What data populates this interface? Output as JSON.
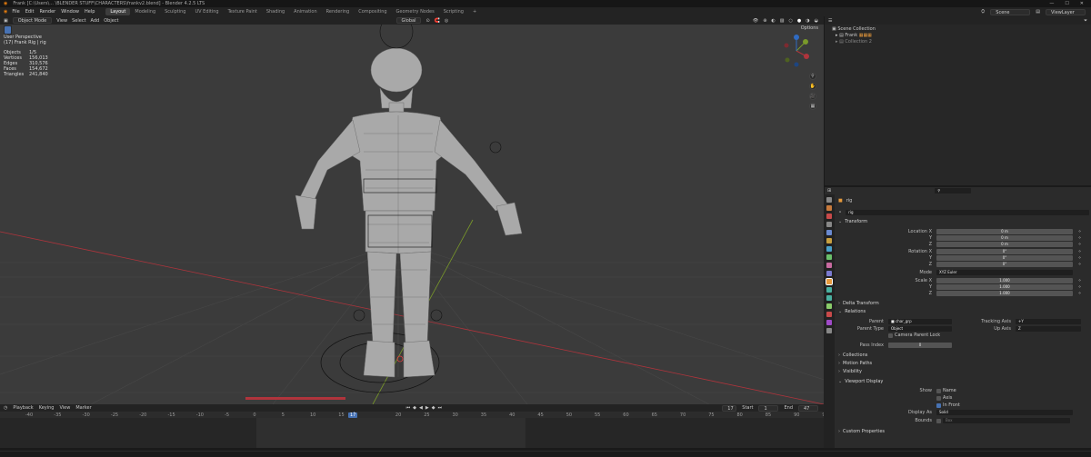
{
  "window": {
    "title": "Frank [C:\\Users\\... \\BLENDER STUFF\\CHARACTERS\\frankv2.blend] - Blender 4.2.5 LTS"
  },
  "menu": [
    "File",
    "Edit",
    "Render",
    "Window",
    "Help"
  ],
  "workspaces": [
    "Layout",
    "Modeling",
    "Sculpting",
    "UV Editing",
    "Texture Paint",
    "Shading",
    "Animation",
    "Rendering",
    "Compositing",
    "Geometry Nodes",
    "Scripting",
    "+"
  ],
  "active_workspace": "Layout",
  "scene_label": "Scene",
  "viewlayer_label": "ViewLayer",
  "viewport": {
    "mode": "Object Mode",
    "header_menus": [
      "View",
      "Select",
      "Add",
      "Object"
    ],
    "transform": "Global",
    "options": "Options",
    "info": {
      "view": "User Perspective",
      "collection": "(17) Frank Rig | rig"
    },
    "stats": [
      [
        "Objects",
        "1/5"
      ],
      [
        "Vertices",
        "156,013"
      ],
      [
        "Edges",
        "310,576"
      ],
      [
        "Faces",
        "154,672"
      ],
      [
        "Triangles",
        "241,840"
      ]
    ]
  },
  "timeline": {
    "menus": [
      "Playback",
      "Keying",
      "View",
      "Marker"
    ],
    "current_frame": "17",
    "start_label": "Start",
    "start": "1",
    "end_label": "End",
    "end": "47",
    "ticks": [
      "-40",
      "-35",
      "-30",
      "-25",
      "-20",
      "-15",
      "-10",
      "-5",
      "0",
      "5",
      "10",
      "15",
      "17",
      "20",
      "25",
      "30",
      "35",
      "40",
      "45",
      "50",
      "55",
      "60",
      "65",
      "70",
      "75",
      "80",
      "85",
      "90",
      "95"
    ]
  },
  "outliner": {
    "root": "Scene Collection",
    "items": [
      "Frank",
      "Collection 2"
    ]
  },
  "properties": {
    "object_name": "rig",
    "data_name": "rig",
    "transform_label": "Transform",
    "location": [
      {
        "label": "Location X",
        "value": "0 m"
      },
      {
        "label": "Y",
        "value": "0 m"
      },
      {
        "label": "Z",
        "value": "0 m"
      }
    ],
    "rotation": [
      {
        "label": "Rotation X",
        "value": "0°"
      },
      {
        "label": "Y",
        "value": "0°"
      },
      {
        "label": "Z",
        "value": "0°"
      }
    ],
    "mode_label": "Mode",
    "mode_value": "XYZ Euler",
    "scale": [
      {
        "label": "Scale X",
        "value": "1.000"
      },
      {
        "label": "Y",
        "value": "1.000"
      },
      {
        "label": "Z",
        "value": "1.000"
      }
    ],
    "delta_transform": "Delta Transform",
    "relations_label": "Relations",
    "parent_label": "Parent",
    "parent_value": "char_grp",
    "parent_type_label": "Parent Type",
    "parent_type_value": "Object",
    "camera_parent_lock": "Camera Parent Lock",
    "pass_index_label": "Pass Index",
    "pass_index_value": "0",
    "tracking_axis_label": "Tracking Axis",
    "tracking_axis_value": "+Y",
    "up_axis_label": "Up Axis",
    "up_axis_value": "Z",
    "sections": [
      "Collections",
      "Motion Paths",
      "Visibility"
    ],
    "viewport_display_label": "Viewport Display",
    "show_label": "Show",
    "show_name": "Name",
    "show_axis": "Axis",
    "show_in_front": "In Front",
    "display_as_label": "Display As",
    "display_as_value": "Solid",
    "bounds_label": "Bounds",
    "bounds_value": "Box",
    "custom_props": "Custom Properties"
  },
  "colors": {
    "accent": "#4772b3",
    "viewport": "#3b3b3b",
    "x_axis": "#b0343c",
    "y_axis": "#7a9a2a"
  }
}
